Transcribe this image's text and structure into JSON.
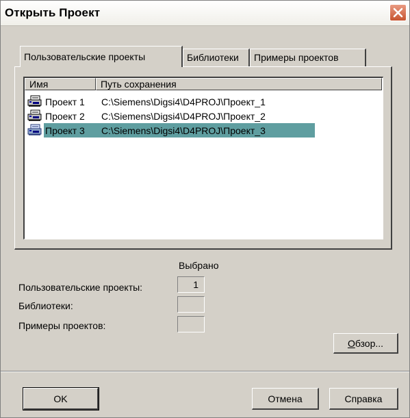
{
  "window": {
    "title": "Открыть Проект",
    "close_icon": "close-icon"
  },
  "tabs": [
    {
      "label": "Пользовательские проекты",
      "active": true
    },
    {
      "label": "Библиотеки",
      "active": false
    },
    {
      "label": "Примеры проектов",
      "active": false
    }
  ],
  "list": {
    "columns": [
      "Имя",
      "Путь сохранения"
    ],
    "rows": [
      {
        "icon": "project-icon",
        "name": "Проект 1",
        "path": "C:\\Siemens\\Digsi4\\D4PROJ\\Проект_1",
        "selected": false
      },
      {
        "icon": "project-icon",
        "name": "Проект 2",
        "path": "C:\\Siemens\\Digsi4\\D4PROJ\\Проект_2",
        "selected": false
      },
      {
        "icon": "project-icon",
        "name": "Проект 3",
        "path": "C:\\Siemens\\Digsi4\\D4PROJ\\Проект_3",
        "selected": true
      }
    ]
  },
  "summary": {
    "heading": "Выбрано",
    "items": [
      {
        "label": "Пользовательские проекты:",
        "value": "1"
      },
      {
        "label": "Библиотеки:",
        "value": ""
      },
      {
        "label": "Примеры проектов:",
        "value": ""
      }
    ]
  },
  "buttons": {
    "browse_u": "О",
    "browse_rest": "бзор...",
    "ok": "OK",
    "cancel": "Отмена",
    "help": "Справка"
  },
  "colors": {
    "face": "#d4d0c8",
    "selection": "#5f9ea0",
    "close_button": "#c7542f"
  }
}
